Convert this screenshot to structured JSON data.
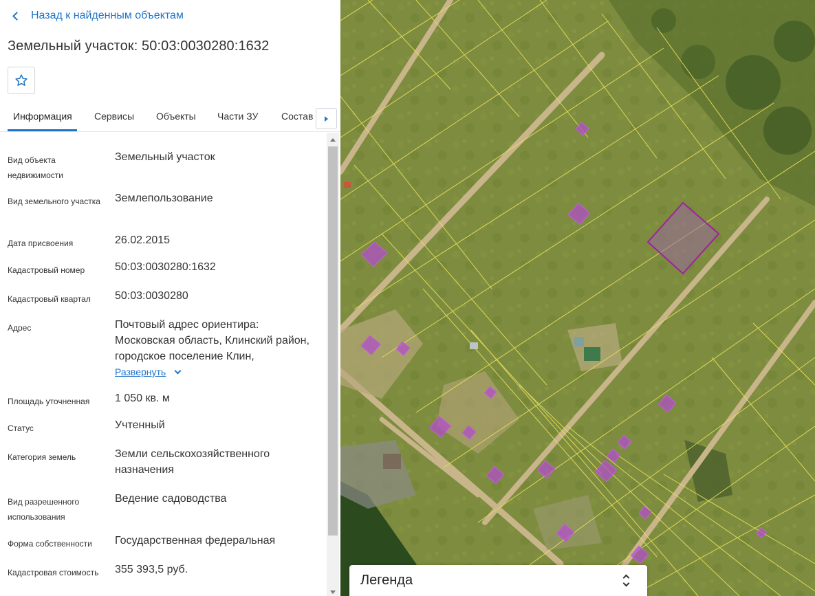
{
  "nav": {
    "back_label": "Назад к найденным объектам"
  },
  "header": {
    "title": "Земельный участок: 50:03:0030280:1632"
  },
  "tabs": [
    {
      "label": "Информация",
      "active": true
    },
    {
      "label": "Сервисы",
      "active": false
    },
    {
      "label": "Объекты",
      "active": false
    },
    {
      "label": "Части ЗУ",
      "active": false
    },
    {
      "label": "Состав",
      "active": false
    }
  ],
  "info": {
    "rows": [
      {
        "label": "Вид объекта недвижимости",
        "value": "Земельный участок"
      },
      {
        "label": "Вид земельного участка",
        "value": "Землепользование"
      },
      {
        "label": "Дата присвоения",
        "value": "26.02.2015"
      },
      {
        "label": "Кадастровый номер",
        "value": "50:03:0030280:1632"
      },
      {
        "label": "Кадастровый квартал",
        "value": "50:03:0030280"
      },
      {
        "label": "Адрес",
        "value": "Почтовый адрес ориентира: Московская область, Клинский район, городское поселение Клин,"
      },
      {
        "label": "Площадь уточненная",
        "value": "1 050 кв. м"
      },
      {
        "label": "Статус",
        "value": "Учтенный"
      },
      {
        "label": "Категория земель",
        "value": "Земли сельскохозяйственного назначения"
      },
      {
        "label": "Вид разрешенного использования",
        "value": "Ведение садоводства"
      },
      {
        "label": "Форма собственности",
        "value": "Государственная федеральная"
      },
      {
        "label": "Кадастровая стоимость",
        "value": "355 393,5 руб."
      }
    ],
    "expand_label": "Развернуть"
  },
  "legend": {
    "title": "Легенда"
  },
  "colors": {
    "accent": "#1e74c9",
    "parcel_outline": "#e8e05a",
    "building_fill": "#b14fc9",
    "selected_outline": "#a020a0"
  },
  "icons": {
    "back": "chevron-left-icon",
    "favorite": "star-outline-icon",
    "tabs_next": "triangle-right-icon",
    "expand": "chevron-down-icon",
    "legend_toggle": "updown-chevron-icon"
  }
}
